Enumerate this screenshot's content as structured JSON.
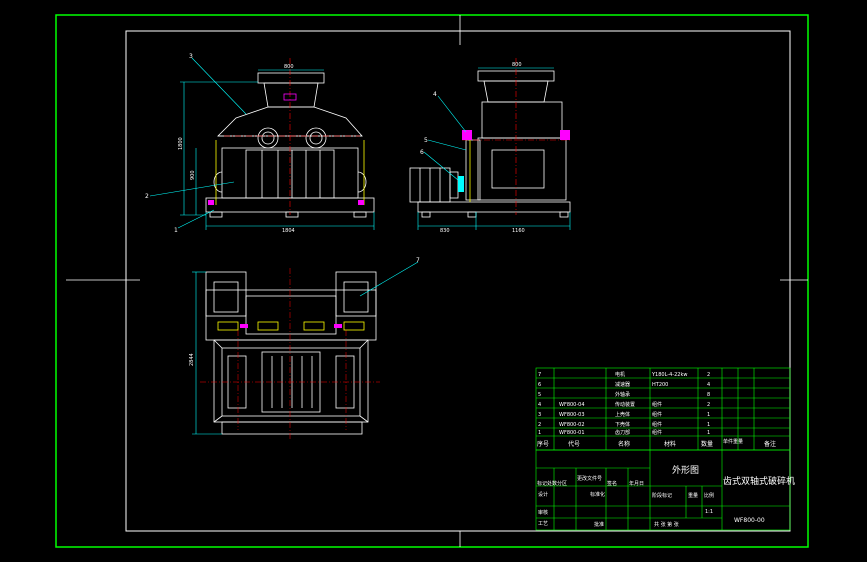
{
  "colors": {
    "background": "#000000",
    "frame": "#ffffff",
    "border": "#00ff00",
    "outline": "#ffffff",
    "dimension": "#00ffff",
    "centerline": "#ff0000",
    "leader": "#00ffff",
    "accent": "#ff00ff",
    "yellow": "#ffff00"
  },
  "dimensions": {
    "front_top": "800",
    "front_height": "1800",
    "front_mid": "900",
    "front_bottom": "1804",
    "side_top": "800",
    "side_left": "830",
    "side_right": "1160",
    "plan_height": "2844"
  },
  "callouts": [
    "1",
    "2",
    "3",
    "4",
    "5",
    "6",
    "7"
  ],
  "parts_list": {
    "rows": [
      {
        "no": "7",
        "code": "",
        "name": "电机",
        "material": "Y180L-4-22kw",
        "qty": "2",
        "remark": ""
      },
      {
        "no": "6",
        "code": "",
        "name": "减速器",
        "material": "HT200",
        "qty": "4",
        "remark": ""
      },
      {
        "no": "5",
        "code": "",
        "name": "外轴承",
        "material": "",
        "qty": "8",
        "remark": ""
      },
      {
        "no": "4",
        "code": "WF800-04",
        "name": "传动装置",
        "material": "组件",
        "qty": "2",
        "remark": ""
      },
      {
        "no": "3",
        "code": "WF800-03",
        "name": "上壳体",
        "material": "组件",
        "qty": "1",
        "remark": ""
      },
      {
        "no": "2",
        "code": "WF800-02",
        "name": "下壳体",
        "material": "组件",
        "qty": "1",
        "remark": ""
      },
      {
        "no": "1",
        "code": "WF800-01",
        "name": "齿刀部",
        "material": "组件",
        "qty": "1",
        "remark": ""
      }
    ],
    "header": {
      "no": "序号",
      "code": "代号",
      "name": "名称",
      "material": "材料",
      "qty": "数量",
      "unit_weight": "单件重量",
      "remark": "备注"
    }
  },
  "title_block": {
    "drawing_title": "外形图",
    "machine_name": "齿式双轴式破碎机",
    "drawing_no": "WF800-00",
    "scale": "1:1",
    "labels": {
      "mark_count_zone": "标记处数分区",
      "change_doc": "更改文件号",
      "signature": "签名",
      "date": "年月日",
      "design": "设计",
      "standardize": "标准化",
      "stage_mark": "阶段标记",
      "weight": "重量",
      "ratio": "比例",
      "review": "审核",
      "process": "工艺",
      "approve": "批准",
      "sheet_total": "共 张 第 张"
    }
  }
}
